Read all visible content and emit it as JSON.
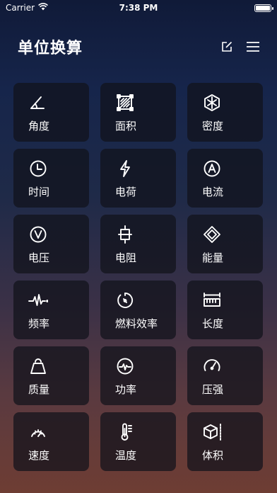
{
  "status_bar": {
    "carrier": "Carrier",
    "time": "7:38 PM",
    "battery_level": 1.0
  },
  "header": {
    "title": "单位换算",
    "edit_icon": "edit-icon",
    "menu_icon": "menu-icon"
  },
  "tiles": [
    {
      "label": "角度",
      "icon": "angle-icon"
    },
    {
      "label": "面积",
      "icon": "area-icon"
    },
    {
      "label": "密度",
      "icon": "density-icon"
    },
    {
      "label": "时间",
      "icon": "clock-icon"
    },
    {
      "label": "电荷",
      "icon": "lightning-icon"
    },
    {
      "label": "电流",
      "icon": "ampere-icon"
    },
    {
      "label": "电压",
      "icon": "volt-icon"
    },
    {
      "label": "电阻",
      "icon": "resistor-icon"
    },
    {
      "label": "能量",
      "icon": "energy-icon"
    },
    {
      "label": "频率",
      "icon": "waveform-icon"
    },
    {
      "label": "燃料效率",
      "icon": "fuel-efficiency-icon"
    },
    {
      "label": "长度",
      "icon": "ruler-icon"
    },
    {
      "label": "质量",
      "icon": "weight-icon"
    },
    {
      "label": "功率",
      "icon": "power-icon"
    },
    {
      "label": "压强",
      "icon": "gauge-icon"
    },
    {
      "label": "速度",
      "icon": "speedometer-icon"
    },
    {
      "label": "温度",
      "icon": "thermometer-icon"
    },
    {
      "label": "体积",
      "icon": "cube-icon"
    }
  ]
}
